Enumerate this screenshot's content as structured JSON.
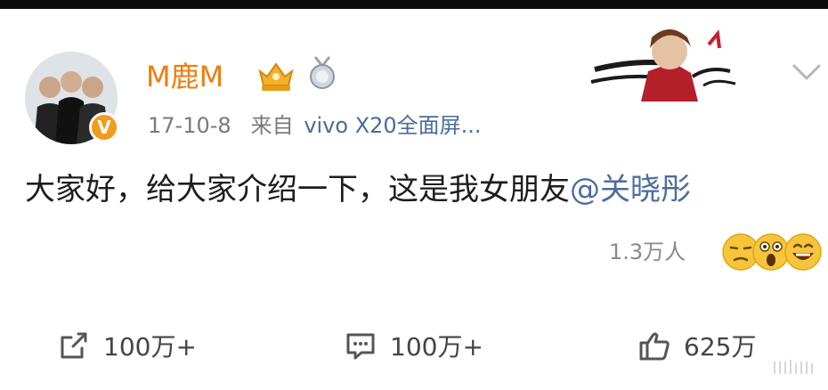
{
  "post": {
    "username": "M鹿M",
    "date": "17-10-8",
    "source_prefix": "来自",
    "device": "vivo X20全面屏...",
    "content_text": "大家好，给大家介绍一下，这是我女朋友",
    "mention": "@关晓彤",
    "reactions_count": "1.3万人"
  },
  "actions": {
    "repost_count": "100万+",
    "comment_count": "100万+",
    "like_count": "625万"
  },
  "icons": {
    "verified": "verified-v-badge-icon",
    "crown": "vip-crown-badge-icon",
    "medal": "medal-badge-icon",
    "expand": "chevron-down-icon",
    "repost": "repost-icon",
    "comment": "comment-icon",
    "like": "thumbs-up-icon"
  },
  "colors": {
    "username": "#eb7e10",
    "mention": "#4d6d9d",
    "verified_badge": "#f29b1c"
  }
}
